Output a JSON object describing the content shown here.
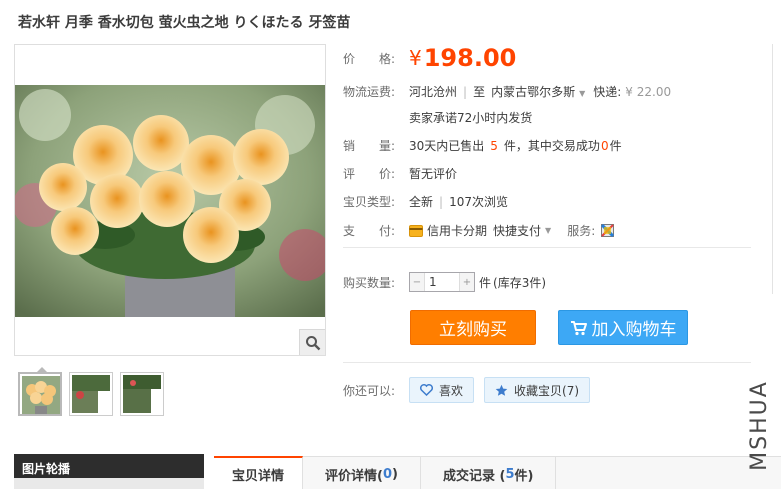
{
  "product": {
    "title": "若水轩 月季 香水切包 萤火虫之地 りくほたる 牙签苗"
  },
  "gallery": {
    "thumbnail_count": 3
  },
  "price": {
    "label": "价　　格:",
    "currency": "¥",
    "value": "198.00"
  },
  "shipping": {
    "label": "物流运费:",
    "from": "河北沧州",
    "to_prefix": "至",
    "to": "内蒙古鄂尔多斯",
    "express_label": "快递:",
    "express_fee": "¥ 22.00",
    "promise": "卖家承诺72小时内发货"
  },
  "sales": {
    "label": "销　　量:",
    "text_1": "30天内已售出",
    "sold_count": "5",
    "text_2": "件，其中交易成功",
    "success_count": "0",
    "text_3": "件"
  },
  "rating": {
    "label": "评　　价:",
    "value": "暂无评价"
  },
  "item_type": {
    "label": "宝贝类型:",
    "value": "全新",
    "views": "107次浏览"
  },
  "payment": {
    "label": "支　　付:",
    "credit_card": "信用卡分期",
    "quick_pay": "快捷支付",
    "service_label": "服务:"
  },
  "quantity": {
    "label": "购买数量:",
    "value": "1",
    "unit": "件",
    "stock": "(库存3件)"
  },
  "actions": {
    "buy_now": "立刻购买",
    "add_to_cart": "加入购物车"
  },
  "social": {
    "label": "你还可以:",
    "like": "喜欢",
    "favorite": "收藏宝贝(7)"
  },
  "sidebar": {
    "title": "图片轮播"
  },
  "tabs": [
    {
      "label": "宝贝详情",
      "count": ""
    },
    {
      "label": "评价详情(",
      "count": "0",
      "suffix": ")"
    },
    {
      "label": "成交记录 (",
      "count": "5",
      "suffix": "件)"
    }
  ],
  "watermark": "MSHUA",
  "colors": {
    "price": "#ff4400",
    "buy_button": "#ff7e00",
    "cart_button": "#3da8f5",
    "link_count": "#3d7ccd"
  }
}
